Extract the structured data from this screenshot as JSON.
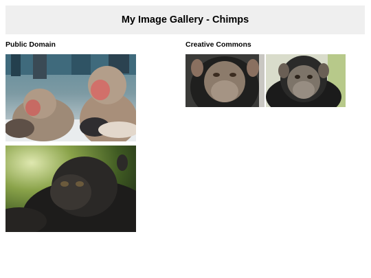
{
  "header": {
    "title": "My Image Gallery - Chimps"
  },
  "sections": [
    {
      "title": "Public Domain",
      "images": [
        {
          "alt": "Two macaque monkeys with red faces in snow"
        },
        {
          "alt": "Gorilla in green forest"
        }
      ]
    },
    {
      "title": "Creative Commons",
      "images": [
        {
          "alt": "Chimpanzee face portrait"
        },
        {
          "alt": "Chimpanzee against light background"
        }
      ]
    }
  ]
}
